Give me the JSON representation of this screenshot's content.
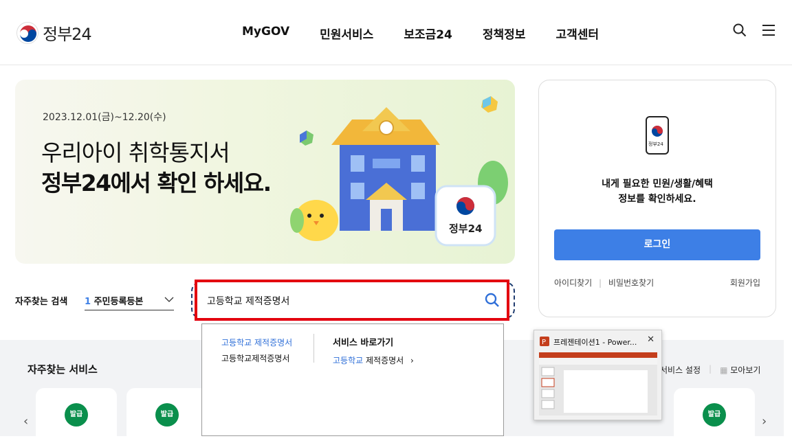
{
  "header": {
    "logo_text": "정부24",
    "nav": [
      "MyGOV",
      "민원서비스",
      "보조금24",
      "정책정보",
      "고객센터"
    ],
    "icons": [
      "search-icon",
      "menu-icon"
    ]
  },
  "banner": {
    "date": "2023.12.01(금)~12.20(수)",
    "line1": "우리아이 취학통지서",
    "line2": "정부24에서 확인 하세요.",
    "badge_text": "정부24"
  },
  "login": {
    "phone_label": "정부24",
    "message_line1": "내게 필요한 민원/생활/혜택",
    "message_line2": "정보를 확인하세요.",
    "button": "로그인",
    "find_id": "아이디찾기",
    "find_pw": "비밀번호찾기",
    "join": "회원가입"
  },
  "favorite_search": {
    "label": "자주찾는 검색",
    "rank": "1",
    "selected": "주민등록등본"
  },
  "search": {
    "value": "고등학교 제적증명서"
  },
  "autocomplete": {
    "suggestions": [
      {
        "highlight": "고등학교",
        "rest": " 제적증명서"
      },
      {
        "highlight": "",
        "rest": "고등학교제적증명서"
      }
    ],
    "shortcut_title": "서비스 바로가기",
    "shortcut_highlight": "고등학교",
    "shortcut_rest": " 제적증명서",
    "shortcut_arrow": "›"
  },
  "services": {
    "title": "자주찾는 서비스",
    "badge": "발급",
    "settings": "서비스 설정",
    "view_all": "모아보기"
  },
  "taskbar_preview": {
    "title": "프레젠테이션1 - Power..."
  },
  "colors": {
    "accent_blue": "#3d7fe6",
    "search_highlight": "#e3000f",
    "badge_green": "#0a8f4c"
  }
}
